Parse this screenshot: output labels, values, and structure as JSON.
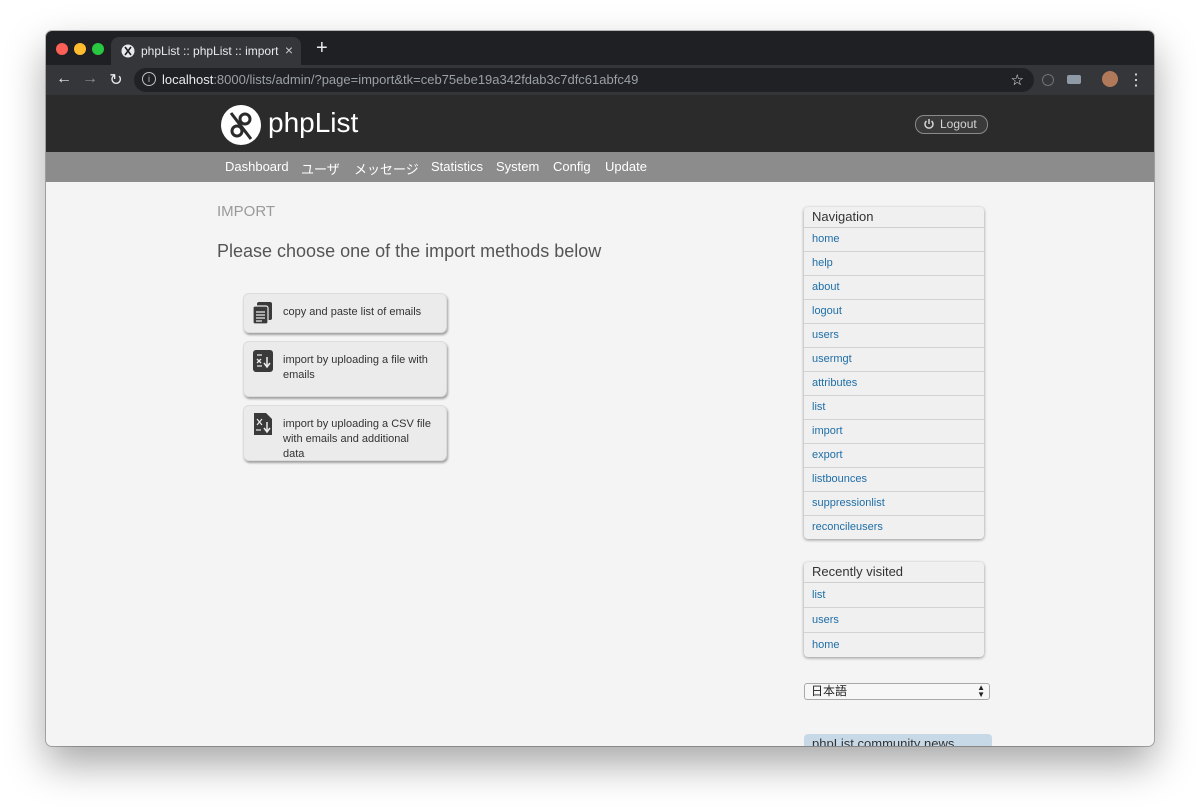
{
  "browser": {
    "tab_title": "phpList :: phpList :: import",
    "tab_close": "×",
    "new_tab": "+",
    "url_host": "localhost",
    "url_rest": ":8000/lists/admin/?page=import&tk=ceb75ebe19a342fdab3c7dfc61abfc49",
    "back": "←",
    "forward": "→",
    "reload": "↻",
    "star": "☆",
    "menu": "⋮"
  },
  "header": {
    "logo_text": "phpList",
    "logout_label": "Logout"
  },
  "menu": {
    "items": [
      "Dashboard",
      "ユーザ",
      "メッセージ",
      "Statistics",
      "System",
      "Config",
      "Update"
    ]
  },
  "main": {
    "page_title": "IMPORT",
    "heading": "Please choose one of the import methods below",
    "methods": [
      {
        "label": "copy and paste list of emails",
        "icon": "clipboard-list-icon"
      },
      {
        "label": "import by uploading a file with emails",
        "icon": "file-upload-icon"
      },
      {
        "label": "import by uploading a CSV file with emails and additional data",
        "icon": "csv-upload-icon"
      }
    ]
  },
  "sidebar": {
    "navigation_title": "Navigation",
    "navigation": [
      "home",
      "help",
      "about",
      "logout",
      "users",
      "usermgt",
      "attributes",
      "list",
      "import",
      "export",
      "listbounces",
      "suppressionlist",
      "reconcileusers"
    ],
    "recent_title": "Recently visited",
    "recent": [
      "list",
      "users",
      "home"
    ],
    "language": "日本語",
    "news_title": "phpList community news"
  },
  "colors": {
    "header_bg": "#2b2b2b",
    "menu_bg": "#8c8c8c",
    "link": "#1e6ea7"
  }
}
